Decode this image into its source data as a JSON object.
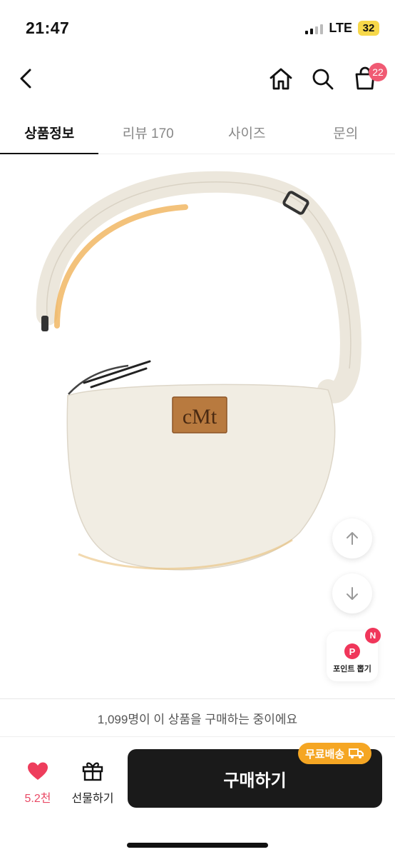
{
  "status": {
    "time": "21:47",
    "network": "LTE",
    "battery": "32"
  },
  "header": {
    "icons": {
      "back": "chevron-left-icon",
      "home": "home-icon",
      "search": "search-icon",
      "bag": "shopping-bag-icon"
    },
    "bag_badge": "22"
  },
  "tabs": [
    {
      "label": "상품정보",
      "active": true
    },
    {
      "label": "리뷰 170",
      "active": false
    },
    {
      "label": "사이즈",
      "active": false
    },
    {
      "label": "문의",
      "active": false
    }
  ],
  "product": {
    "label_text": "cMt"
  },
  "floating": {
    "point_badge": "N",
    "point_icon": "P",
    "point_label": "포인트 뽑기"
  },
  "buyers_text": "1,099명이 이 상품을 구매하는 중이에요",
  "bottom": {
    "like_count": "5.2천",
    "gift_label": "선물하기",
    "buy_label": "구매하기",
    "free_shipping": "무료배송"
  },
  "colors": {
    "accent_pink": "#f05a73",
    "buy_button": "#1a1a1a",
    "free_ship": "#f5a623"
  }
}
